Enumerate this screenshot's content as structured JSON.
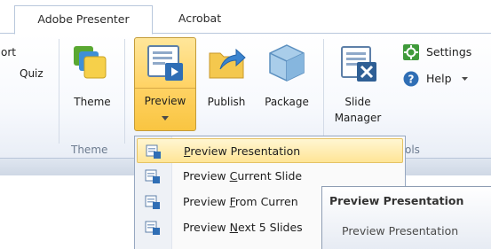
{
  "tabs": [
    {
      "label": "Adobe Presenter",
      "active": true
    },
    {
      "label": "Acrobat",
      "active": false
    }
  ],
  "ribbon": {
    "cut_off_labels": {
      "export_fragment": "ort",
      "quiz": "Quiz"
    },
    "theme_group": {
      "theme_label": "Theme",
      "group_label": "Theme"
    },
    "presentation_group": {
      "preview_label": "Preview",
      "publish_label": "Publish",
      "package_label": "Package",
      "group_label_fragment": ""
    },
    "tools_group": {
      "slide_manager_label_line1": "Slide",
      "slide_manager_label_line2": "Manager",
      "settings_label": "Settings",
      "help_label": "Help",
      "group_label_fragment": "ols"
    }
  },
  "preview_menu": {
    "items": [
      {
        "pre": "",
        "accel": "P",
        "post": "review Presentation",
        "highlighted": true
      },
      {
        "pre": "Preview ",
        "accel": "C",
        "post": "urrent Slide",
        "highlighted": false
      },
      {
        "pre": "Preview ",
        "accel": "F",
        "post": "rom Curren",
        "highlighted": false
      },
      {
        "pre": "Preview ",
        "accel": "N",
        "post": "ext 5 Slides",
        "highlighted": false
      }
    ]
  },
  "tooltip": {
    "title": "Preview Presentation",
    "body": "Preview Presentation"
  },
  "colors": {
    "accent_orange": "#ffd263",
    "ribbon_border": "#b8c7dc",
    "menu_border": "#97a8c1",
    "icon_blue": "#2f6eb5",
    "icon_green": "#5aa832"
  },
  "icons": [
    "theme-icon",
    "preview-icon",
    "publish-icon",
    "package-icon",
    "slide-manager-icon",
    "settings-icon",
    "help-icon",
    "dropdown-arrow-icon"
  ]
}
